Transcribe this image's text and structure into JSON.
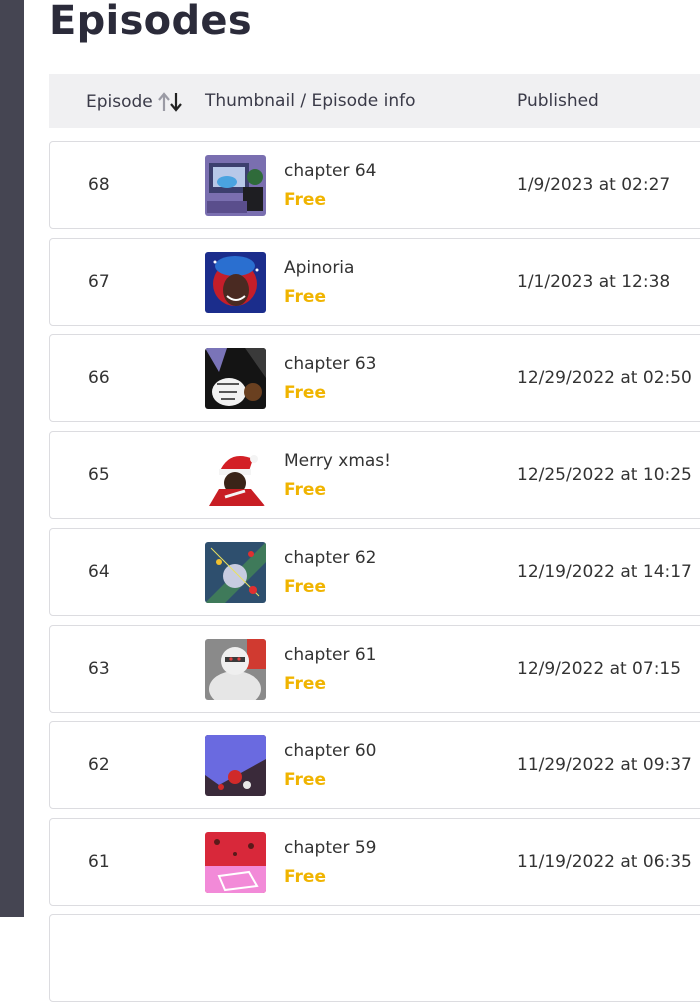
{
  "page": {
    "title": "Episodes"
  },
  "table": {
    "headers": {
      "episode": "Episode",
      "thumbnail": "Thumbnail / Episode info",
      "published": "Published"
    },
    "sort_icon": "sort-up-down-icon",
    "rows": [
      {
        "number": "68",
        "title": "chapter 64",
        "price": "Free",
        "published": "1/9/2023 at 02:27"
      },
      {
        "number": "67",
        "title": "Apinoria",
        "price": "Free",
        "published": "1/1/2023 at 12:38"
      },
      {
        "number": "66",
        "title": "chapter 63",
        "price": "Free",
        "published": "12/29/2022 at 02:50"
      },
      {
        "number": "65",
        "title": "Merry xmas!",
        "price": "Free",
        "published": "12/25/2022 at 10:25"
      },
      {
        "number": "64",
        "title": "chapter 62",
        "price": "Free",
        "published": "12/19/2022 at 14:17"
      },
      {
        "number": "63",
        "title": "chapter 61",
        "price": "Free",
        "published": "12/9/2022 at 07:15"
      },
      {
        "number": "62",
        "title": "chapter 60",
        "price": "Free",
        "published": "11/29/2022 at 09:37"
      },
      {
        "number": "61",
        "title": "chapter 59",
        "price": "Free",
        "published": "11/19/2022 at 06:35"
      }
    ]
  },
  "colors": {
    "sidebar": "#454552",
    "header_bg": "#f0f0f2",
    "free_price": "#f0b400",
    "title": "#2b2b3a"
  }
}
